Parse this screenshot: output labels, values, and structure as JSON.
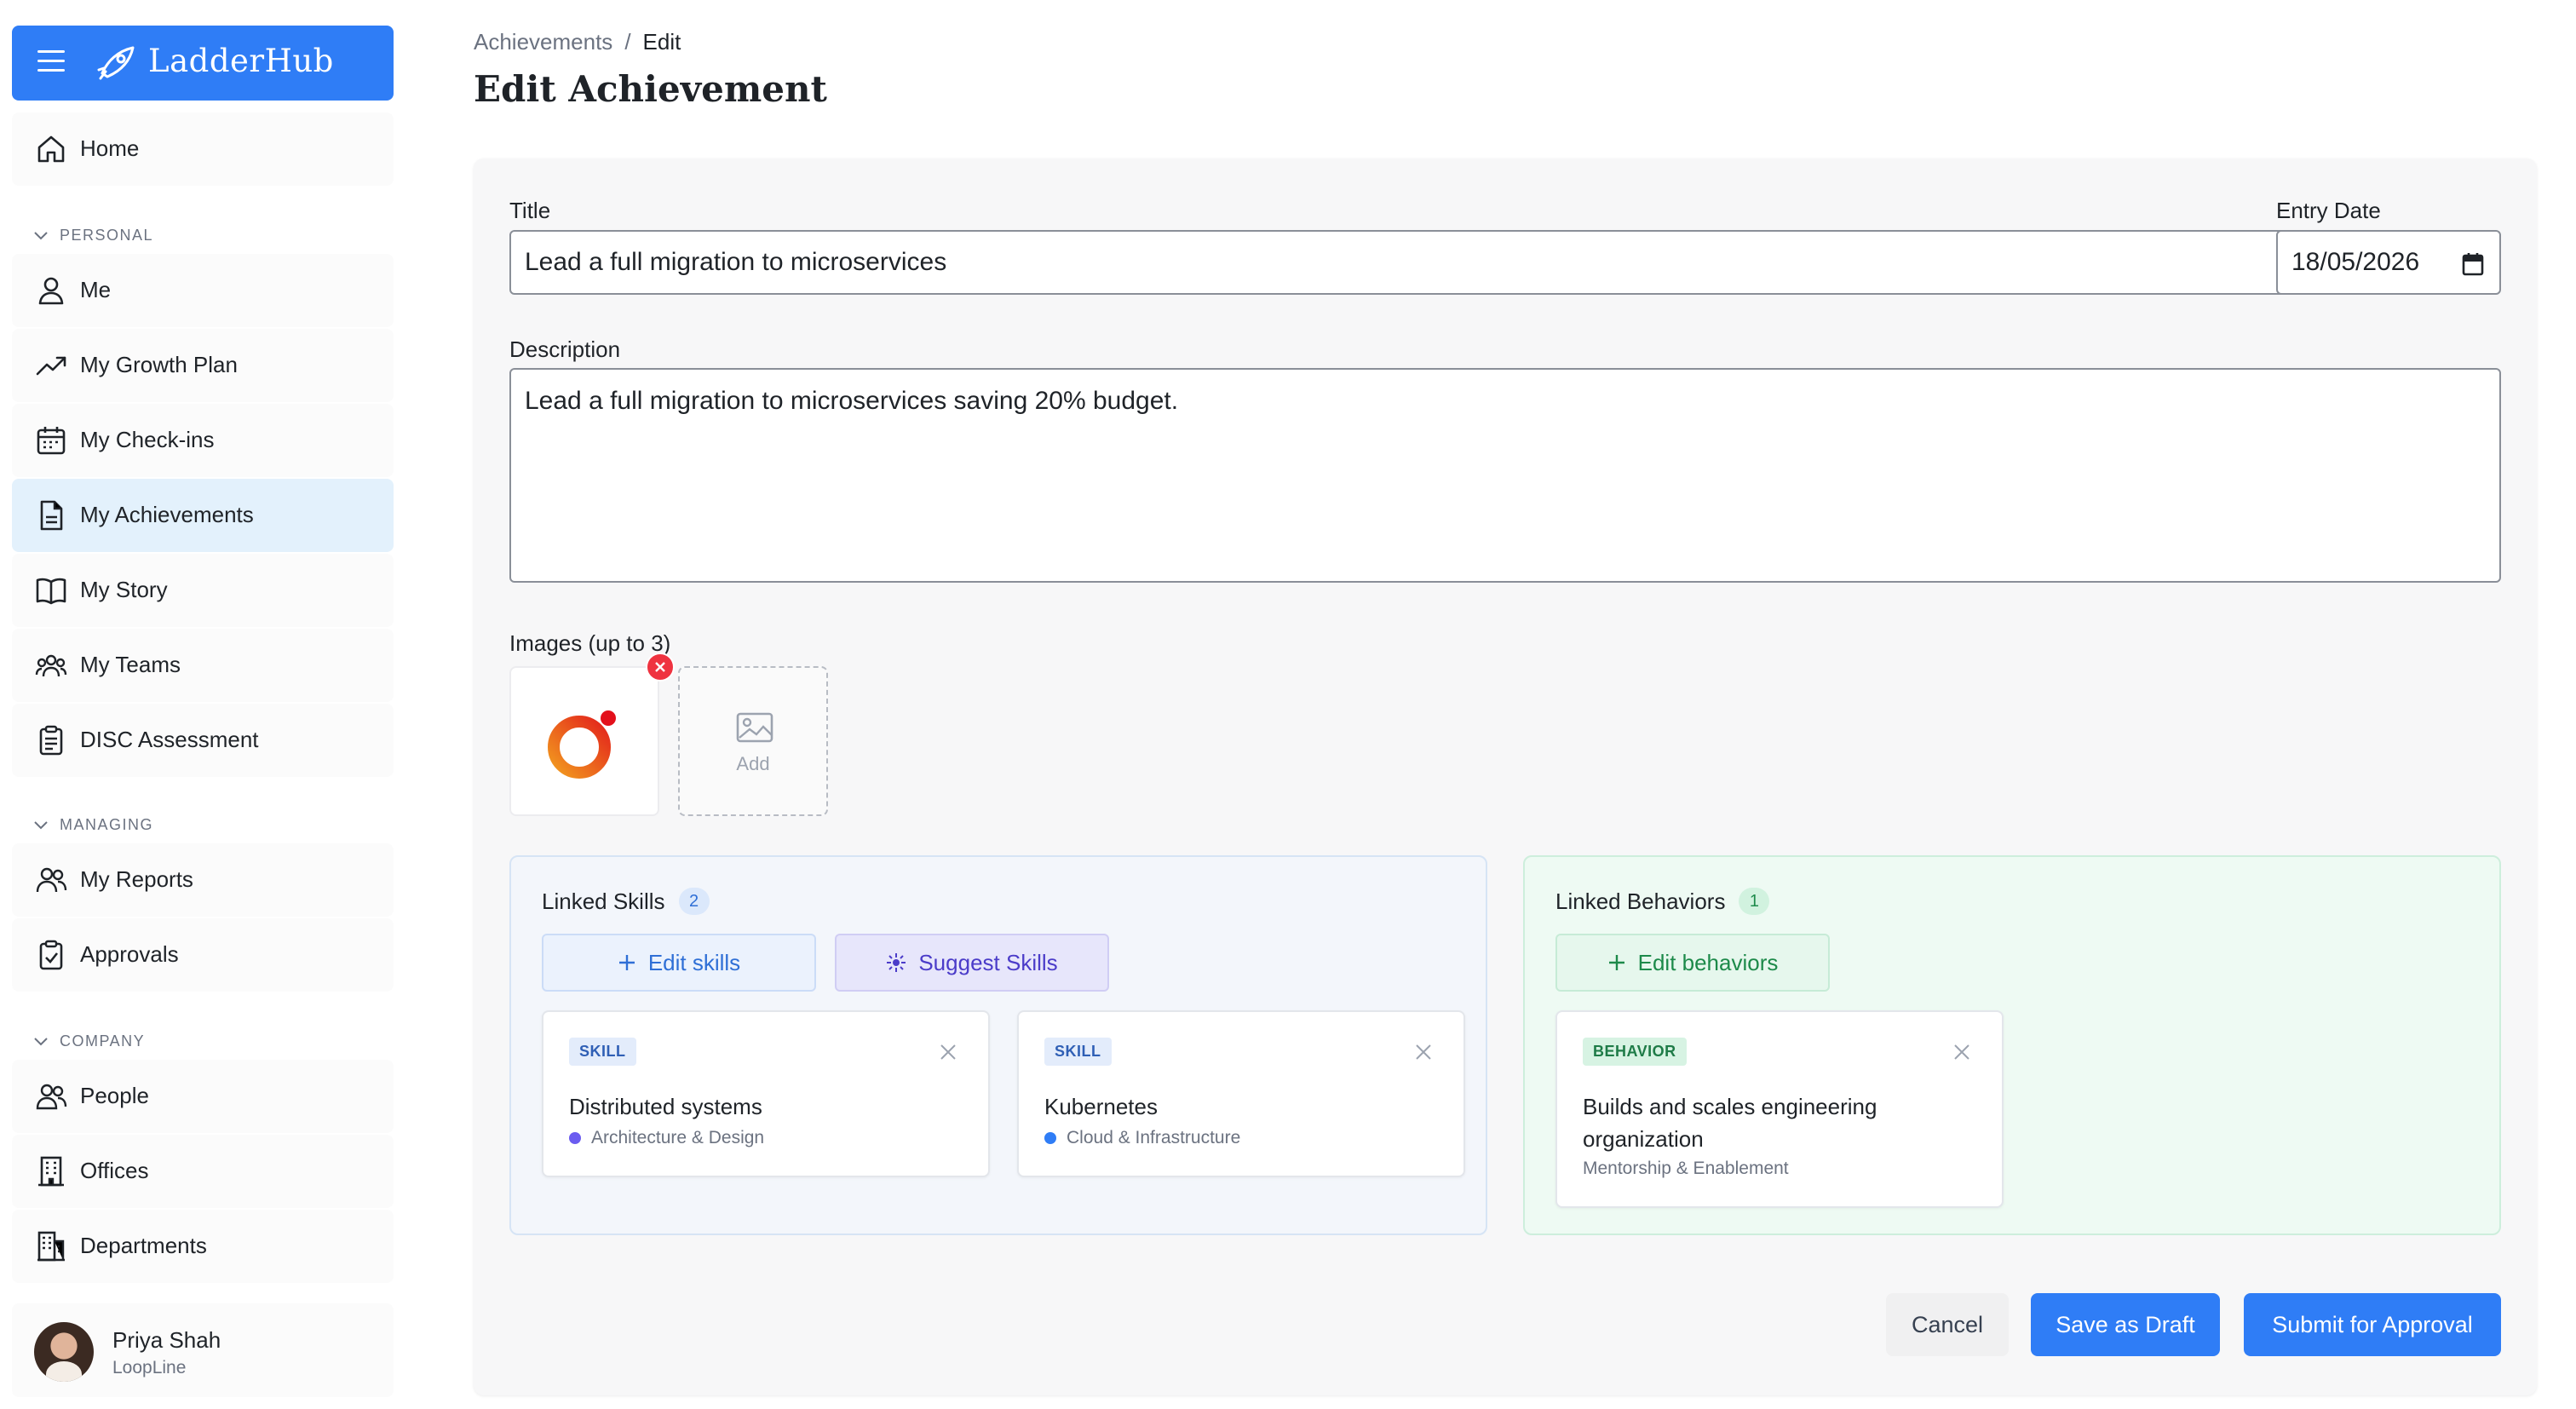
{
  "app": {
    "name": "LadderHub"
  },
  "sidebar": {
    "home": "Home",
    "sections": {
      "personal": "PERSONAL",
      "managing": "MANAGING",
      "company": "COMPANY"
    },
    "personal_items": [
      "Me",
      "My Growth Plan",
      "My Check-ins",
      "My Achievements",
      "My Story",
      "My Teams",
      "DISC Assessment"
    ],
    "managing_items": [
      "My Reports",
      "Approvals"
    ],
    "company_items": [
      "People",
      "Offices",
      "Departments"
    ],
    "active_item": "My Achievements",
    "user": {
      "name": "Priya Shah",
      "org": "LoopLine"
    }
  },
  "breadcrumb": {
    "parent": "Achievements",
    "separator": "/",
    "current": "Edit"
  },
  "page_title": "Edit Achievement",
  "form": {
    "title_label": "Title",
    "title_value": "Lead a full migration to microservices",
    "date_label": "Entry Date",
    "date_value": "18/05/2026",
    "description_label": "Description",
    "description_value": "Lead a full migration to microservices saving 20% budget.",
    "images_label": "Images (up to 3)",
    "add_image_label": "Add"
  },
  "linked_skills": {
    "title": "Linked Skills",
    "count": "2",
    "edit_button": "Edit skills",
    "suggest_button": "Suggest Skills",
    "items": [
      {
        "tag": "SKILL",
        "name": "Distributed systems",
        "category": "Architecture & Design",
        "dot_color": "#6b5cf0"
      },
      {
        "tag": "SKILL",
        "name": "Kubernetes",
        "category": "Cloud & Infrastructure",
        "dot_color": "#2f7df6"
      }
    ]
  },
  "linked_behaviors": {
    "title": "Linked Behaviors",
    "count": "1",
    "edit_button": "Edit behaviors",
    "items": [
      {
        "tag": "BEHAVIOR",
        "name": "Builds and scales engineering organization",
        "category": "Mentorship & Enablement"
      }
    ]
  },
  "actions": {
    "cancel": "Cancel",
    "draft": "Save as Draft",
    "submit": "Submit for Approval"
  },
  "colors": {
    "primary": "#2f7df6",
    "active_nav": "#e3f1fc",
    "danger": "#ef3340"
  }
}
